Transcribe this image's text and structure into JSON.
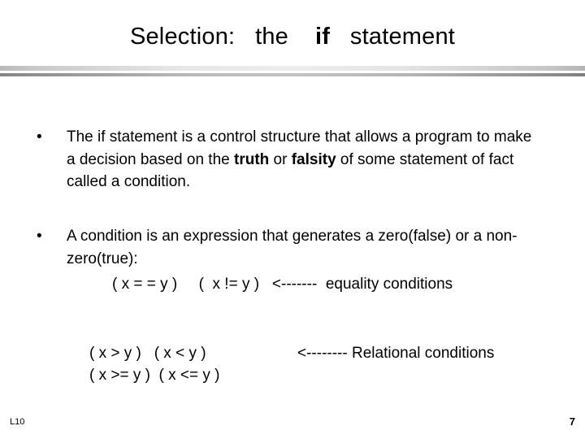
{
  "slide": {
    "title": {
      "before": "Selection:   the    ",
      "keyword": "if",
      "after": "   statement"
    },
    "bullets": [
      {
        "marker": "•",
        "segments": [
          {
            "text": "The if statement is a control structure that allows a program to make a decision based on the ",
            "bold": false
          },
          {
            "text": "truth",
            "bold": true
          },
          {
            "text": " or ",
            "bold": false
          },
          {
            "text": "falsity",
            "bold": true
          },
          {
            "text": " of some statement of fact called a condition.",
            "bold": false
          }
        ]
      },
      {
        "marker": "•",
        "segments": [
          {
            "text": "A condition is an expression that generates a zero(false) or a non-zero(true):",
            "bold": false
          }
        ]
      }
    ],
    "code": {
      "equality_line": "( x = = y )     (  x != y )   <-------  equality conditions",
      "relational_line_1": "( x > y )   ( x < y )",
      "relational_line_2": "( x >= y )  ( x <= y )",
      "relational_note": "<-------- Relational conditions"
    },
    "footer": {
      "left_label": "L10",
      "page_number": "7"
    },
    "colors": {
      "background": "#ffffff",
      "text": "#000000",
      "rule_light": "#e6e6e6",
      "rule_dark": "#848484"
    }
  }
}
